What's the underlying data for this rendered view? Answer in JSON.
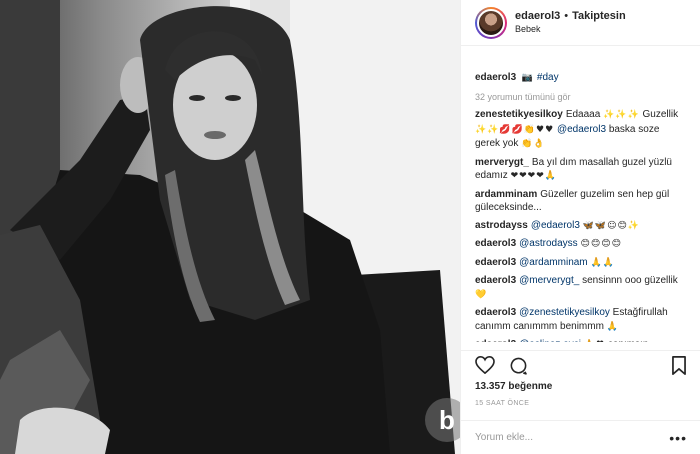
{
  "header": {
    "username": "edaerol3",
    "separator": "•",
    "follow_status": "Takiptesin",
    "location": "Bebek"
  },
  "caption": {
    "username": "edaerol3",
    "emoji": "📷",
    "hashtag": "#day"
  },
  "view_all_comments": "32 yorumun tümünü gör",
  "comments": [
    {
      "username": "zenestetikyesilkoy",
      "parts": [
        {
          "kind": "text",
          "value": "Edaaaa"
        },
        {
          "kind": "emoji",
          "value": "✨✨✨"
        },
        {
          "kind": "text",
          "value": "Guzellik"
        },
        {
          "kind": "emoji",
          "value": "✨✨💋💋👏♥♥"
        },
        {
          "kind": "mention",
          "value": "@edaerol3"
        },
        {
          "kind": "text",
          "value": "baska soze gerek yok"
        },
        {
          "kind": "emoji",
          "value": "👏👌"
        }
      ]
    },
    {
      "username": "merverygt_",
      "parts": [
        {
          "kind": "text",
          "value": "Ba yıl dım masallah guzel yüzlü edamız"
        },
        {
          "kind": "emoji",
          "value": "❤❤❤❤🙏"
        }
      ]
    },
    {
      "username": "ardamminam",
      "parts": [
        {
          "kind": "text",
          "value": "Güzeller guzelim sen hep gül güleceksinde..."
        }
      ]
    },
    {
      "username": "astrodayss",
      "parts": [
        {
          "kind": "mention",
          "value": "@edaerol3"
        },
        {
          "kind": "emoji",
          "value": "🦋🦋☺😊✨"
        }
      ]
    },
    {
      "username": "edaerol3",
      "parts": [
        {
          "kind": "mention",
          "value": "@astrodayss"
        },
        {
          "kind": "emoji",
          "value": "😊😊😊😊"
        }
      ]
    },
    {
      "username": "edaerol3",
      "parts": [
        {
          "kind": "mention",
          "value": "@ardamminam"
        },
        {
          "kind": "emoji",
          "value": "🙏🙏"
        }
      ]
    },
    {
      "username": "edaerol3",
      "parts": [
        {
          "kind": "mention",
          "value": "@merverygt_"
        },
        {
          "kind": "text",
          "value": "sensinnn ooo güzellik"
        },
        {
          "kind": "emoji",
          "value": "💛"
        }
      ]
    },
    {
      "username": "edaerol3",
      "parts": [
        {
          "kind": "mention",
          "value": "@zenestetikyesilkoy"
        },
        {
          "kind": "text",
          "value": "Estağfirullah canımm canımmm benimmm"
        },
        {
          "kind": "emoji",
          "value": "🙏"
        }
      ]
    },
    {
      "username": "edaerol3",
      "parts": [
        {
          "kind": "mention",
          "value": "@aslinaz.avci"
        },
        {
          "kind": "emoji",
          "value": "🙏♥"
        },
        {
          "kind": "text",
          "value": "canımsın"
        }
      ]
    }
  ],
  "actions": {
    "likes": "13.357 beğenme",
    "time": "15 SAAT ÖNCE"
  },
  "add_comment": {
    "placeholder": "Yorum ekle...",
    "more": "•••"
  },
  "watermark": "b",
  "colors": {
    "link": "#003569",
    "meta": "#999999",
    "text": "#262626",
    "border": "#efefef"
  }
}
